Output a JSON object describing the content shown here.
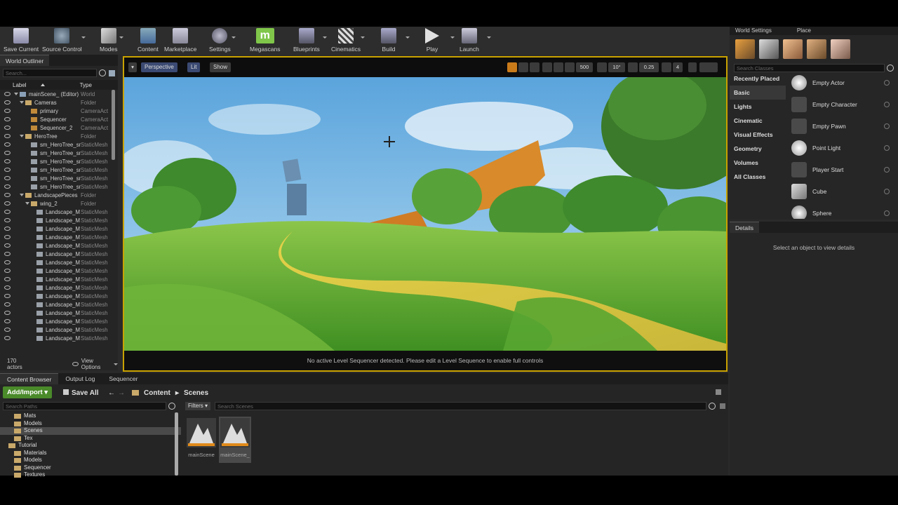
{
  "toolbar": {
    "buttons": [
      {
        "label": "Save Current"
      },
      {
        "label": "Source Control"
      },
      {
        "label": "Modes"
      },
      {
        "label": "Content"
      },
      {
        "label": "Marketplace"
      },
      {
        "label": "Settings"
      },
      {
        "label": "Megascans"
      },
      {
        "label": "Blueprints"
      },
      {
        "label": "Cinematics"
      },
      {
        "label": "Build"
      },
      {
        "label": "Play"
      },
      {
        "label": "Launch"
      }
    ]
  },
  "outliner": {
    "tab": "World Outliner",
    "search_placeholder": "Search...",
    "col_label": "Label",
    "col_type": "Type",
    "rows": [
      {
        "name": "mainScene_ (Editor)",
        "type": "World"
      },
      {
        "name": "Cameras",
        "type": "Folder"
      },
      {
        "name": "primary",
        "type": "CameraAct"
      },
      {
        "name": "Sequencer",
        "type": "CameraAct"
      },
      {
        "name": "Sequencer_2",
        "type": "CameraAct"
      },
      {
        "name": "HeroTree",
        "type": "Folder"
      },
      {
        "name": "sm_HeroTree_sm",
        "type": "StaticMesh"
      },
      {
        "name": "sm_HeroTree_sm",
        "type": "StaticMesh"
      },
      {
        "name": "sm_HeroTree_sm",
        "type": "StaticMesh"
      },
      {
        "name": "sm_HeroTree_sm",
        "type": "StaticMesh"
      },
      {
        "name": "sm_HeroTree_sm",
        "type": "StaticMesh"
      },
      {
        "name": "sm_HeroTree_sm",
        "type": "StaticMesh"
      },
      {
        "name": "LandscapePieces",
        "type": "Folder"
      },
      {
        "name": "wing_2",
        "type": "Folder"
      },
      {
        "name": "Landscape_M",
        "type": "StaticMesh"
      },
      {
        "name": "Landscape_M",
        "type": "StaticMesh"
      },
      {
        "name": "Landscape_M",
        "type": "StaticMesh"
      },
      {
        "name": "Landscape_M",
        "type": "StaticMesh"
      },
      {
        "name": "Landscape_M",
        "type": "StaticMesh"
      },
      {
        "name": "Landscape_M",
        "type": "StaticMesh"
      },
      {
        "name": "Landscape_M",
        "type": "StaticMesh"
      },
      {
        "name": "Landscape_M",
        "type": "StaticMesh"
      },
      {
        "name": "Landscape_M",
        "type": "StaticMesh"
      },
      {
        "name": "Landscape_M",
        "type": "StaticMesh"
      },
      {
        "name": "Landscape_M",
        "type": "StaticMesh"
      },
      {
        "name": "Landscape_M",
        "type": "StaticMesh"
      },
      {
        "name": "Landscape_M",
        "type": "StaticMesh"
      },
      {
        "name": "Landscape_M",
        "type": "StaticMesh"
      },
      {
        "name": "Landscape_M",
        "type": "StaticMesh"
      },
      {
        "name": "Landscape_M",
        "type": "StaticMesh"
      }
    ],
    "actor_count": "170 actors",
    "view_options": "View Options"
  },
  "viewport": {
    "perspective": "Perspective",
    "lit": "Lit",
    "show": "Show",
    "grid_value": "500",
    "rotation_value": "10°",
    "scale_value": "0.25",
    "camera_speed": "4",
    "status": "No active Level Sequencer detected. Please edit a Level Sequence to enable full controls"
  },
  "place": {
    "tabs": [
      "World Settings",
      "Place"
    ],
    "search_placeholder": "Search Classes",
    "categories": [
      "Recently Placed",
      "Basic",
      "Lights",
      "Cinematic",
      "Visual Effects",
      "Geometry",
      "Volumes",
      "All Classes"
    ],
    "items": [
      "Empty Actor",
      "Empty Character",
      "Empty Pawn",
      "Point Light",
      "Player Start",
      "Cube",
      "Sphere"
    ]
  },
  "details": {
    "tab": "Details",
    "message": "Select an object to view details"
  },
  "content_browser": {
    "tabs": [
      "Content Browser",
      "Output Log",
      "Sequencer"
    ],
    "add_import": "Add/Import",
    "save_all": "Save All",
    "breadcrumb": [
      "Content",
      "Scenes"
    ],
    "search_paths_placeholder": "Search Paths",
    "filters": "Filters",
    "search_assets_placeholder": "Search Scenes",
    "paths": [
      {
        "name": "Mats",
        "indent": 1
      },
      {
        "name": "Models",
        "indent": 1
      },
      {
        "name": "Scenes",
        "indent": 1,
        "selected": true
      },
      {
        "name": "Tex",
        "indent": 1
      },
      {
        "name": "Tutorial",
        "indent": 0
      },
      {
        "name": "Materials",
        "indent": 1
      },
      {
        "name": "Models",
        "indent": 1
      },
      {
        "name": "Sequencer",
        "indent": 1
      },
      {
        "name": "Textures",
        "indent": 1
      }
    ],
    "assets": [
      "mainScene",
      "mainScene_"
    ]
  },
  "colors": {
    "viewport_border": "#c9a200",
    "add_button": "#4a8a2a"
  }
}
